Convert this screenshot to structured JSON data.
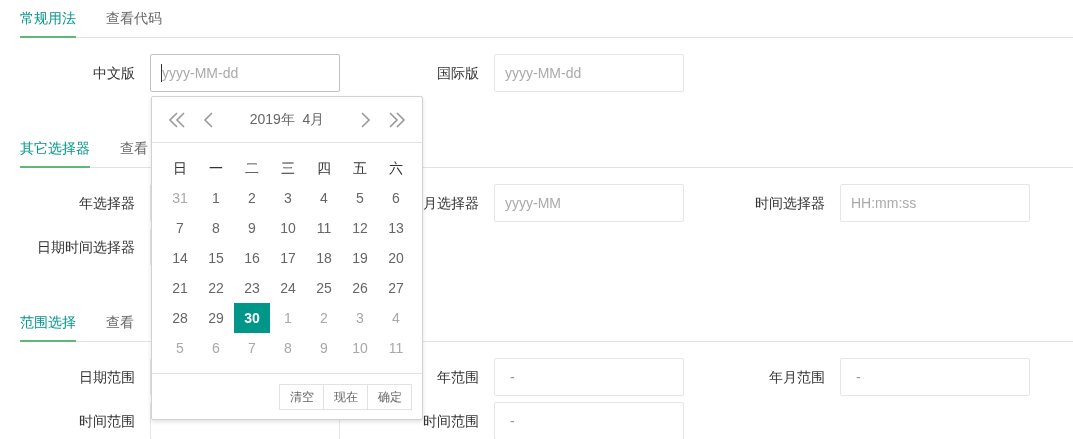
{
  "sections": [
    {
      "tabs": [
        {
          "label": "常规用法",
          "selected": true
        },
        {
          "label": "查看代码",
          "selected": false
        }
      ],
      "rows": [
        [
          {
            "label": "中文版",
            "placeholder": "yyyy-MM-dd",
            "focused": true
          },
          {
            "label": "国际版",
            "placeholder": "yyyy-MM-dd"
          }
        ]
      ]
    },
    {
      "tabs": [
        {
          "label": "其它选择器",
          "selected": true
        },
        {
          "label": "查看",
          "selected": false
        }
      ],
      "rows": [
        [
          {
            "label": "年选择器"
          },
          {
            "label": "月选择器",
            "placeholder": "yyyy-MM"
          },
          {
            "label": "时间选择器",
            "placeholder": "HH:mm:ss"
          }
        ],
        [
          {
            "label": "日期时间选择器"
          }
        ]
      ]
    },
    {
      "tabs": [
        {
          "label": "范围选择",
          "selected": true
        },
        {
          "label": "查看",
          "selected": false
        }
      ],
      "rows": [
        [
          {
            "label": "日期范围"
          },
          {
            "label": "年范围",
            "value": "-"
          },
          {
            "label": "年月范围",
            "value": "-"
          }
        ],
        [
          {
            "label": "时间范围"
          },
          {
            "label": "时间范围",
            "value": "-"
          }
        ]
      ]
    }
  ],
  "date_picker": {
    "title": "2019年  4月",
    "weekdays": [
      "日",
      "一",
      "二",
      "三",
      "四",
      "五",
      "六"
    ],
    "days": [
      {
        "text": "31",
        "muted": true,
        "selected": false
      },
      {
        "text": "1",
        "muted": false,
        "selected": false
      },
      {
        "text": "2",
        "muted": false,
        "selected": false
      },
      {
        "text": "3",
        "muted": false,
        "selected": false
      },
      {
        "text": "4",
        "muted": false,
        "selected": false
      },
      {
        "text": "5",
        "muted": false,
        "selected": false
      },
      {
        "text": "6",
        "muted": false,
        "selected": false
      },
      {
        "text": "7",
        "muted": false,
        "selected": false
      },
      {
        "text": "8",
        "muted": false,
        "selected": false
      },
      {
        "text": "9",
        "muted": false,
        "selected": false
      },
      {
        "text": "10",
        "muted": false,
        "selected": false
      },
      {
        "text": "11",
        "muted": false,
        "selected": false
      },
      {
        "text": "12",
        "muted": false,
        "selected": false
      },
      {
        "text": "13",
        "muted": false,
        "selected": false
      },
      {
        "text": "14",
        "muted": false,
        "selected": false
      },
      {
        "text": "15",
        "muted": false,
        "selected": false
      },
      {
        "text": "16",
        "muted": false,
        "selected": false
      },
      {
        "text": "17",
        "muted": false,
        "selected": false
      },
      {
        "text": "18",
        "muted": false,
        "selected": false
      },
      {
        "text": "19",
        "muted": false,
        "selected": false
      },
      {
        "text": "20",
        "muted": false,
        "selected": false
      },
      {
        "text": "21",
        "muted": false,
        "selected": false
      },
      {
        "text": "22",
        "muted": false,
        "selected": false
      },
      {
        "text": "23",
        "muted": false,
        "selected": false
      },
      {
        "text": "24",
        "muted": false,
        "selected": false
      },
      {
        "text": "25",
        "muted": false,
        "selected": false
      },
      {
        "text": "26",
        "muted": false,
        "selected": false
      },
      {
        "text": "27",
        "muted": false,
        "selected": false
      },
      {
        "text": "28",
        "muted": false,
        "selected": false
      },
      {
        "text": "29",
        "muted": false,
        "selected": false
      },
      {
        "text": "30",
        "muted": false,
        "selected": true
      },
      {
        "text": "1",
        "muted": true,
        "selected": false
      },
      {
        "text": "2",
        "muted": true,
        "selected": false
      },
      {
        "text": "3",
        "muted": true,
        "selected": false
      },
      {
        "text": "4",
        "muted": true,
        "selected": false
      },
      {
        "text": "5",
        "muted": true,
        "selected": false
      },
      {
        "text": "6",
        "muted": true,
        "selected": false
      },
      {
        "text": "7",
        "muted": true,
        "selected": false
      },
      {
        "text": "8",
        "muted": true,
        "selected": false
      },
      {
        "text": "9",
        "muted": true,
        "selected": false
      },
      {
        "text": "10",
        "muted": true,
        "selected": false
      },
      {
        "text": "11",
        "muted": true,
        "selected": false
      }
    ],
    "buttons": [
      "清空",
      "现在",
      "确定"
    ]
  }
}
